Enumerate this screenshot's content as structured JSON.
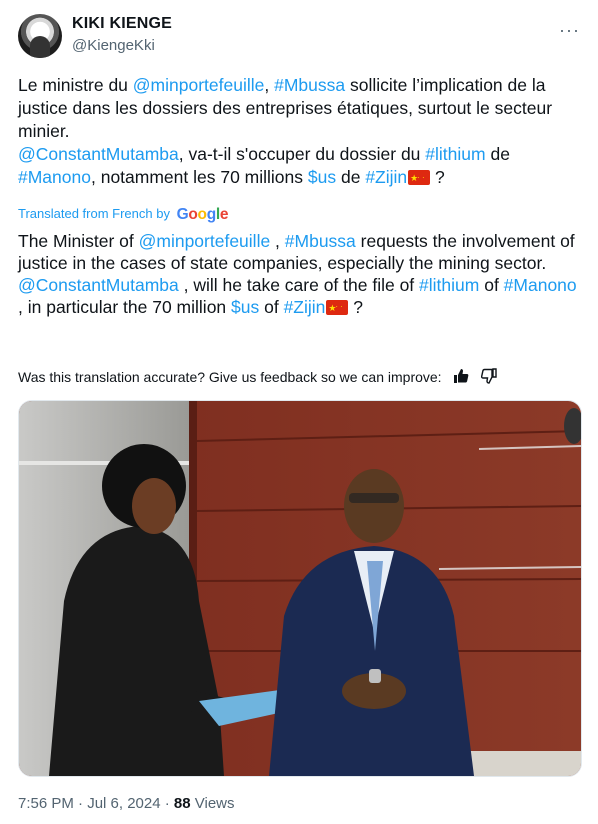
{
  "author": {
    "name": "KIKI KIENGE",
    "handle": "@KiengeKki"
  },
  "more_label": "···",
  "original": {
    "p1": [
      {
        "t": "Le ministre du ",
        "link": false
      },
      {
        "t": "@minportefeuille",
        "link": true
      },
      {
        "t": ", ",
        "link": false
      },
      {
        "t": "#Mbussa",
        "link": true
      },
      {
        "t": " sollicite l’implication de la justice dans les dossiers  des entreprises étatiques, surtout le secteur minier.",
        "link": false
      }
    ],
    "p2": [
      {
        "t": "@ConstantMutamba",
        "link": true
      },
      {
        "t": ", va-t-il s'occuper du dossier du ",
        "link": false
      },
      {
        "t": "#lithium",
        "link": true
      },
      {
        "t": " de ",
        "link": false
      },
      {
        "t": "#Manono",
        "link": true
      },
      {
        "t": ", notamment les 70 millions ",
        "link": false
      },
      {
        "t": "$us",
        "link": true
      },
      {
        "t": " de ",
        "link": false
      },
      {
        "t": "#Zijin",
        "link": true
      },
      {
        "t": "FLAG",
        "link": false
      },
      {
        "t": " ?",
        "link": false
      }
    ]
  },
  "translated_label": "Translated from French by",
  "google_label": "Google",
  "translation": {
    "p1": [
      {
        "t": "The Minister of ",
        "link": false
      },
      {
        "t": "@minportefeuille",
        "link": true
      },
      {
        "t": " , ",
        "link": false
      },
      {
        "t": "#Mbussa",
        "link": true
      },
      {
        "t": " requests the involvement of justice in the cases of state companies, especially the mining sector.",
        "link": false
      }
    ],
    "p2": [
      {
        "t": "@ConstantMutamba",
        "link": true
      },
      {
        "t": " , will he take care of the file of ",
        "link": false
      },
      {
        "t": "#lithium",
        "link": true
      },
      {
        "t": " of ",
        "link": false
      },
      {
        "t": "#Manono",
        "link": true
      },
      {
        "t": " , in particular the 70 million ",
        "link": false
      },
      {
        "t": "$us",
        "link": true
      },
      {
        "t": " of ",
        "link": false
      },
      {
        "t": "#Zijin",
        "link": true
      },
      {
        "t": "FLAG",
        "link": false
      },
      {
        "t": " ?",
        "link": false
      }
    ]
  },
  "feedback": {
    "text": "Was this translation accurate? Give us feedback so we can improve:",
    "thumb_up_icon": "thumbs-up-icon",
    "thumb_down_icon": "thumbs-down-icon"
  },
  "photo": {
    "alt_subject": "two men exchanging a document"
  },
  "footer": {
    "time": "7:56 PM · Jul 6, 2024 · ",
    "views_count": "88",
    "views_label": " Views"
  },
  "colors": {
    "link": "#1d9bf0",
    "muted": "#536471",
    "text": "#0f1419"
  }
}
